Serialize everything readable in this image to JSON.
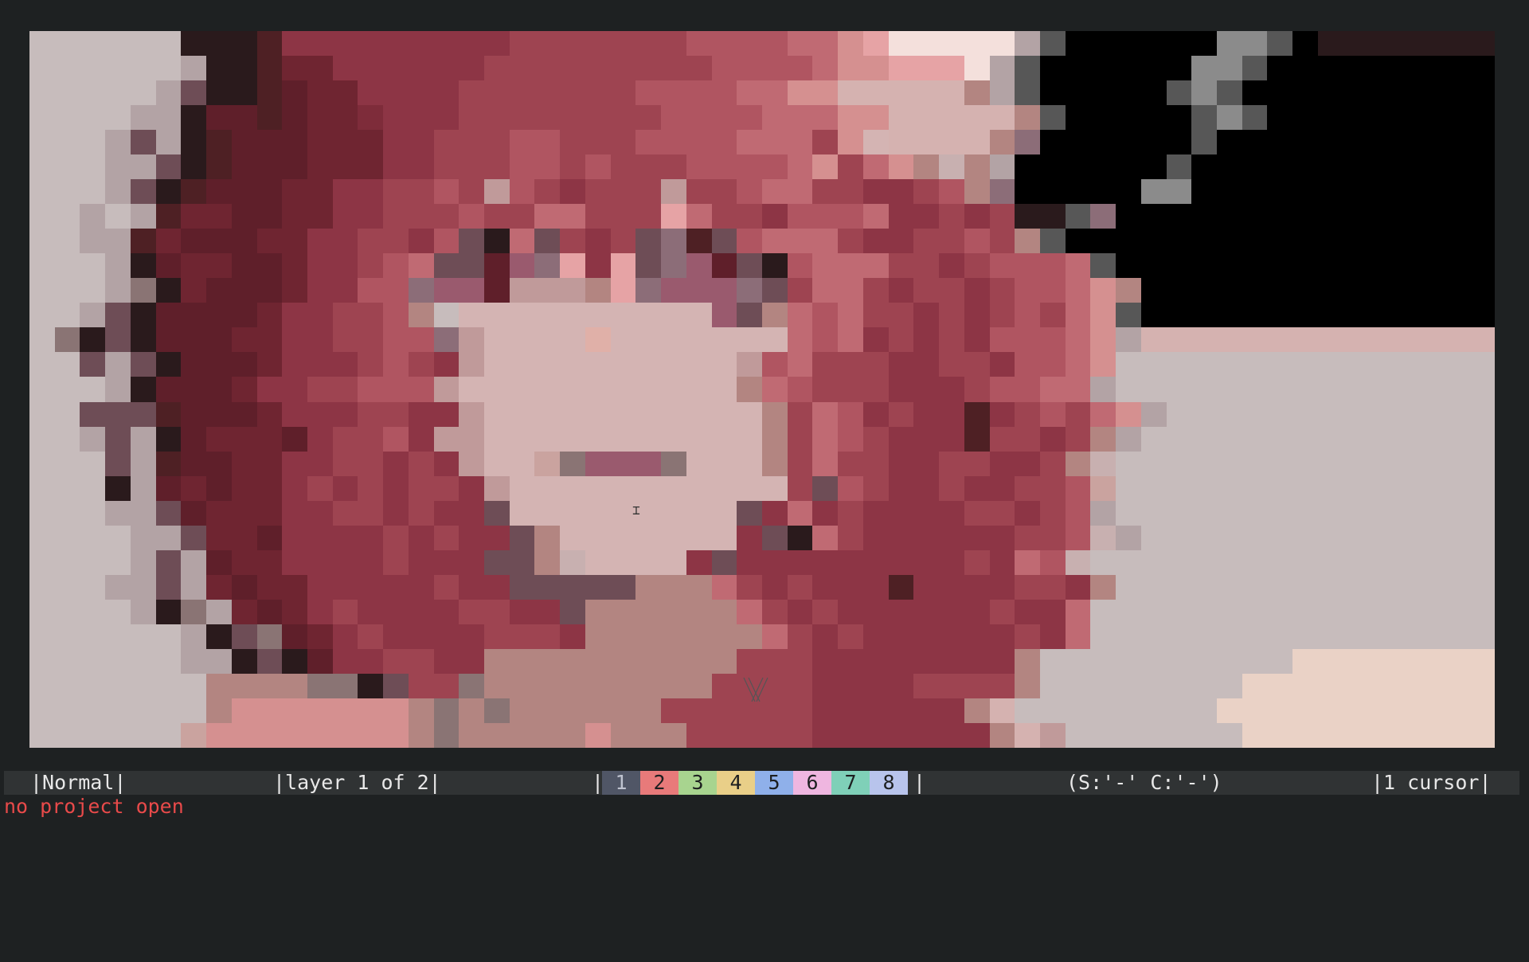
{
  "canvas": {
    "palette_map": {
      "0": "#c7bcbc",
      "1": "#b3a3a5",
      "2": "#2a1a1c",
      "3": "#4e2024",
      "4": "#5f1f2a",
      "5": "#6f2531",
      "6": "#7e2c3a",
      "7": "#8d3545",
      "8": "#9e4451",
      "9": "#b05561",
      "a": "#c06a73",
      "b": "#d59090",
      "c": "#e6a3a5",
      "d": "#f4e0dc",
      "e": "#000000",
      "f": "#8b8b8b",
      "g": "#575757",
      "h": "#d5b2b0",
      "i": "#caa39f",
      "j": "#b38581",
      "k": "#6e4d56",
      "l": "#8c6d78",
      "m": "#9a5a6e",
      "n": "#d4b4b3",
      "o": "#c09a9a",
      "p": "#e0b0a8",
      "q": "#c8b0b0",
      "r": "#8a7474",
      "s": "#ead2c6"
    },
    "pixels": [
      "000000222377777777788888889999aabcddddd1geeeeeeffge2",
      "0000001223557777778888888889999abbcccd1geeeeeeffgee",
      "000001k223455777788888889999aabbhhhhhj1geeeeegfgee",
      "00001124434556777888888889999aaabbhhhhhjgeeeeegfgee",
      "0001k12344455577888998889999aaa8bnhhhhjleeeeeegeee",
      "00011k234445557788899898889999ab8abjqj1eeeeeegeee",
      "0001k2344455778898o987888o889aa887789jleeeeeffeee",
      "00101355445577888988aa888ca887999a7787822gleeeeeeee",
      "00113544455778879k2ak878kl3k9aaa8778898jgeeeeeeee",
      "000124554457789akk4mlc7cklm4k29aaa8878999ageeeeeeee",
      "0001r2544457799lmm4ooojclmmmlk8aa87887899abjeeeeeee",
      "001k24444577889j0nnnnnnnnnnmkja9a88787898abgeeeeeee",
      "0r2k244455778899lonnnnpnnnnnnna9a78787999ab1hhhhhhh",
      "00k1k244457778987onnnnnnnnnno9a8887788799ab0000000",
      "0001244457788999onnnnnnnnnnnja9888777899aa100000000",
      "00kkk344457778877onnnnnnnnnnnj8a9787737898ab1000000",
      "001k124555478897oonnnnnnnnnnnj8a9877738878j1000000",
      "000k1344557788787onnirmmmrnnnj8a887788778jq0000000",
      "000214545578787887onnnnnnnnnnn8k9877877889i0000000",
      "00011k455577887877knnnnnnnnnk7a787777887891000000",
      "000011k554777787877kjnnnnnnn7k2a8777777889q10000000",
      "00001k145577778777kkjqnnnn7k77777777787a9q00000000",
      "00011k1545577777877kkkkkjjja87877737777887j00000000",
      "000012r15457877778877kjjjjjja878777777877a000000000",
      "00000012kr457877778887jjjjjjja87877777787a000000000",
      "000000112k24778877jjjjjjjjjj88877777777j0000000000s",
      "0000000jjjjrr2k88rjjjjjjjjj888877778888j00000000ss",
      "0000000jbbbbbbbjrjrjjjjjj888888777777jh00000000sss",
      "000000ibbbbbbbbjrjjjjjbjjj888887777777jho0000000sss"
    ]
  },
  "statusbar": {
    "mode": "|Normal|",
    "layer": "|layer 1 of 2|",
    "left_bar": "|",
    "right_bar": "|",
    "palette": [
      {
        "label": "1",
        "color": "#505666"
      },
      {
        "label": "2",
        "color": "#e87a7a"
      },
      {
        "label": "3",
        "color": "#a8d48f"
      },
      {
        "label": "4",
        "color": "#e9cf88"
      },
      {
        "label": "5",
        "color": "#8fb0ea"
      },
      {
        "label": "6",
        "color": "#efb6e0"
      },
      {
        "label": "7",
        "color": "#7fd0b8"
      },
      {
        "label": "8",
        "color": "#b8c4ec"
      }
    ],
    "selection": "(S:'-' C:'-')",
    "cursor_count": "|1 cursor|"
  },
  "message": "no project open",
  "colors": {
    "background": "#1e2122",
    "statusbar_bg": "#303334",
    "statusbar_text": "#e8e8e8",
    "message_text": "#e84a4a"
  },
  "icons": {
    "mouse_cursor": "i-beam-cursor-icon",
    "brush_cursor": "brush-crosshair-icon"
  }
}
